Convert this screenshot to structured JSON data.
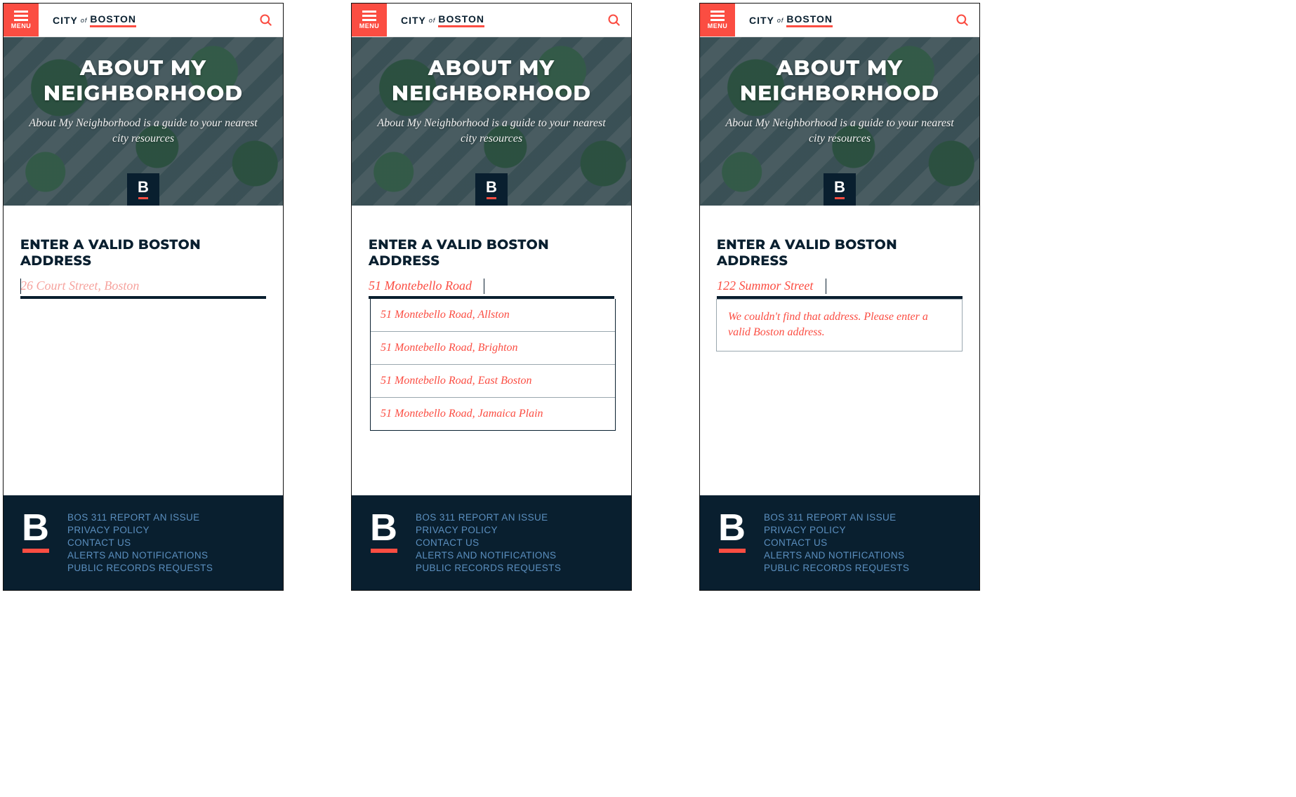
{
  "header": {
    "menu_label": "MENU",
    "brand_city": "CITY",
    "brand_of": "of",
    "brand_boston": "BOSTON"
  },
  "hero": {
    "title": "ABOUT MY NEIGHBORHOOD",
    "subtitle": "About My Neighborhood is a guide to your nearest city resources",
    "badge_letter": "B"
  },
  "main": {
    "prompt": "ENTER A VALID BOSTON ADDRESS"
  },
  "screens": [
    {
      "input_value": "26 Court Street, Boston",
      "is_placeholder": true,
      "mode": "empty"
    },
    {
      "input_value": "51 Montebello Road",
      "is_placeholder": false,
      "mode": "suggestions",
      "suggestions": [
        "51 Montebello Road, Allston",
        "51 Montebello Road, Brighton",
        "51 Montebello Road, East Boston",
        "51 Montebello Road, Jamaica Plain"
      ]
    },
    {
      "input_value": "122 Summor Street",
      "is_placeholder": false,
      "mode": "error",
      "error": "We couldn't find that address. Please enter a valid Boston address."
    }
  ],
  "footer": {
    "badge_letter": "B",
    "links": [
      "BOS 311 REPORT AN ISSUE",
      "PRIVACY POLICY",
      "CONTACT US",
      "ALERTS AND NOTIFICATIONS",
      "PUBLIC RECORDS REQUESTS"
    ]
  }
}
